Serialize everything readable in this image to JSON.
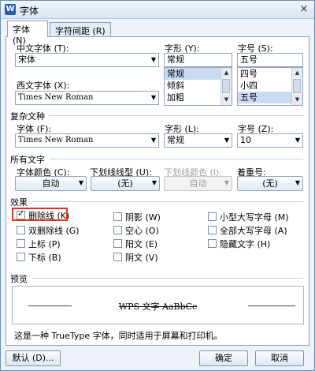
{
  "window": {
    "title": "字体",
    "app_icon": "W",
    "close": "×"
  },
  "tabs": [
    {
      "label": "字体 (N)"
    },
    {
      "label": "字符间距 (R)"
    }
  ],
  "chinese_font": {
    "label": "中文字体 (T):",
    "value": "宋体"
  },
  "style": {
    "label": "字形 (Y):",
    "value": "常规",
    "options": [
      "常规",
      "倾斜",
      "加粗"
    ],
    "selected": "常规"
  },
  "size": {
    "label": "字号 (S):",
    "value": "五号",
    "options": [
      "四号",
      "小四",
      "五号"
    ],
    "selected": "五号"
  },
  "western_font": {
    "label": "西文字体 (X):",
    "value": "Times New Roman"
  },
  "complex": {
    "section": "复杂文种",
    "font_label": "字体 (F):",
    "font_value": "Times New Roman",
    "style_label": "字形 (L):",
    "style_value": "常规",
    "size_label": "字号 (Z):",
    "size_value": "10"
  },
  "all_text": {
    "section": "所有文字",
    "font_color_label": "字体颜色 (C):",
    "font_color_value": "自动",
    "underline_label": "下划线线型 (U):",
    "underline_value": "(无)",
    "underline_color_label": "下划线颜色 (I):",
    "underline_color_value": "自动",
    "emphasis_label": "着重号:",
    "emphasis_value": "(无)"
  },
  "effects": {
    "section": "效果",
    "items": [
      {
        "label": "删除线 (K)",
        "checked": true
      },
      {
        "label": "双删除线 (G)",
        "checked": false
      },
      {
        "label": "上标 (P)",
        "checked": false
      },
      {
        "label": "下标 (B)",
        "checked": false
      },
      {
        "label": "阴影 (W)",
        "checked": false
      },
      {
        "label": "空心 (O)",
        "checked": false
      },
      {
        "label": "阳文 (E)",
        "checked": false
      },
      {
        "label": "阴文 (V)",
        "checked": false
      },
      {
        "label": "小型大写字母 (M)",
        "checked": false
      },
      {
        "label": "全部大写字母 (A)",
        "checked": false
      },
      {
        "label": "隐藏文字 (H)",
        "checked": false
      }
    ]
  },
  "preview": {
    "section": "预览",
    "text": "WPS 文字 AaBbCc"
  },
  "note": "这是一种 TrueType 字体，同时适用于屏幕和打印机。",
  "buttons": {
    "default": "默认 (D)...",
    "ok": "确定",
    "cancel": "取消"
  }
}
